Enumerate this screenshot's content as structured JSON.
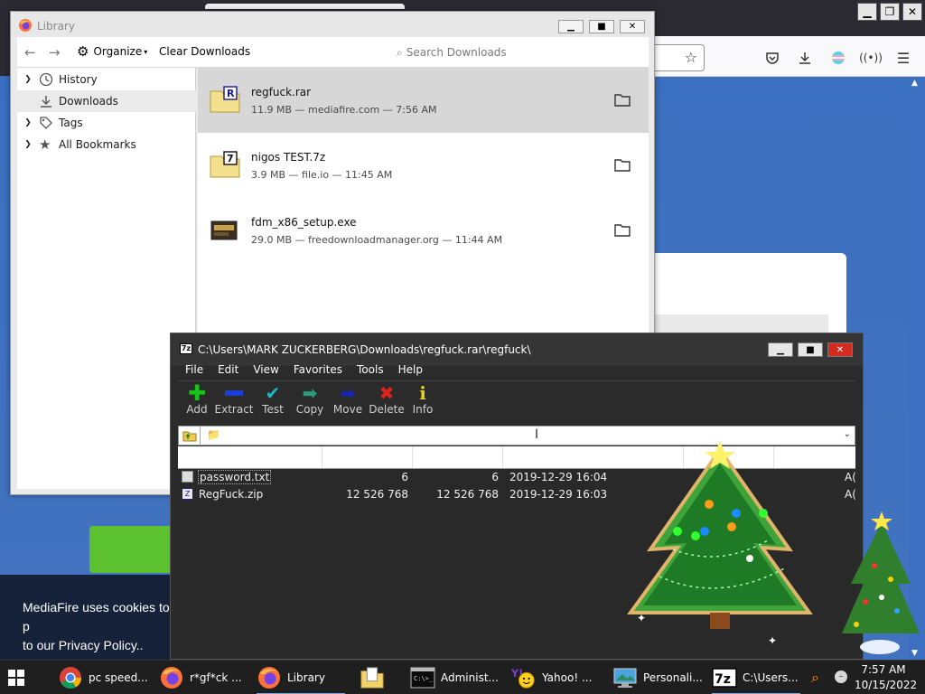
{
  "library": {
    "title": "Library",
    "toolbar": {
      "organize_label": "Organize",
      "clear_label": "Clear Downloads",
      "search_placeholder": "Search Downloads"
    },
    "sidebar": [
      {
        "label": "History",
        "icon": "clock-icon"
      },
      {
        "label": "Downloads",
        "icon": "download-icon",
        "selected": true
      },
      {
        "label": "Tags",
        "icon": "tag-icon"
      },
      {
        "label": "All Bookmarks",
        "icon": "star-icon"
      }
    ],
    "downloads": [
      {
        "name": "regfuck.rar",
        "meta": "11.9 MB — mediafire.com — 7:56 AM",
        "icon": "winrar-archive-icon",
        "selected": true
      },
      {
        "name": "nigos TEST.7z",
        "meta": "3.9 MB — file.io — 11:45 AM",
        "icon": "7z-archive-icon"
      },
      {
        "name": "fdm_x86_setup.exe",
        "meta": "29.0 MB — freedownloadmanager.org — 11:44 AM",
        "icon": "installer-icon"
      }
    ]
  },
  "sevenzip": {
    "title": "C:\\Users\\MARK ZUCKERBERG\\Downloads\\regfuck.rar\\regfuck\\",
    "menu": [
      "File",
      "Edit",
      "View",
      "Favorites",
      "Tools",
      "Help"
    ],
    "toolbar": [
      {
        "label": "Add",
        "icon": "add-icon",
        "color": "#18c418"
      },
      {
        "label": "Extract",
        "icon": "extract-icon",
        "color": "#1a3fd6"
      },
      {
        "label": "Test",
        "icon": "test-icon",
        "color": "#19b7c9"
      },
      {
        "label": "Copy",
        "icon": "copy-icon",
        "color": "#2a9a77"
      },
      {
        "label": "Move",
        "icon": "move-icon",
        "color": "#1427b8"
      },
      {
        "label": "Delete",
        "icon": "delete-icon",
        "color": "#e0221c"
      },
      {
        "label": "Info",
        "icon": "info-icon",
        "color": "#e9d21a"
      }
    ],
    "files": [
      {
        "name": "password.txt",
        "size": "6",
        "packed": "6",
        "modified": "2019-12-29 16:04",
        "attr": "A("
      },
      {
        "name": "RegFuck.zip",
        "size": "12 526 768",
        "packed": "12 526 768",
        "modified": "2019-12-29 16:03",
        "attr": "A("
      }
    ]
  },
  "background": {
    "cookie_text": "MediaFire uses cookies to p",
    "cookie_link": "to our Privacy Policy.."
  },
  "taskbar": {
    "items": [
      {
        "label": "pc speed...",
        "icon": "chrome-icon"
      },
      {
        "label": "r*gf*ck ...",
        "icon": "firefox-icon"
      },
      {
        "label": "Library",
        "icon": "firefox-icon",
        "active": true
      },
      {
        "label": "",
        "icon": "file-explorer-icon"
      },
      {
        "label": "Administ...",
        "icon": "cmd-icon"
      },
      {
        "label": "Yahoo! ...",
        "icon": "yahoo-icon"
      },
      {
        "label": "Personali...",
        "icon": "display-settings-icon"
      },
      {
        "label": "C:\\Users...",
        "icon": "7zip-icon",
        "active": true
      }
    ],
    "time": "7:57 AM",
    "date": "10/15/2022"
  },
  "colors": {
    "desktop_blue": "#3a6cb8",
    "firefox_dark": "#2b2a33",
    "sevenzip_bg": "#2b2b2b",
    "taskbar": "#1f1f1f"
  }
}
